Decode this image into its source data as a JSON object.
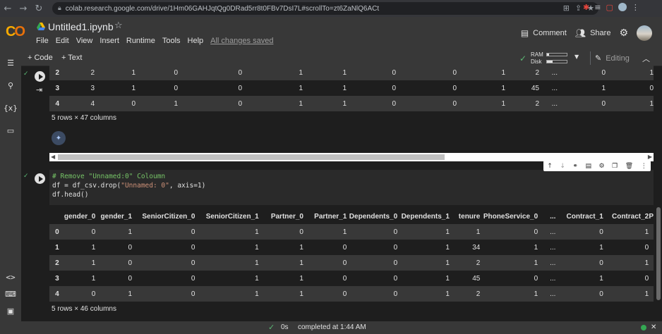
{
  "browser": {
    "url": "colab.research.google.com/drive/1Hm06GAHJqtQg0DRad5rr8t0FBv7DsI7L#scrollTo=zt6ZaNlQ6ACt"
  },
  "header": {
    "title": "Untitled1.ipynb",
    "menu": [
      "File",
      "Edit",
      "View",
      "Insert",
      "Runtime",
      "Tools",
      "Help"
    ],
    "saved_status": "All changes saved",
    "comment_label": "Comment",
    "share_label": "Share"
  },
  "toolbar": {
    "add_code": "+ Code",
    "add_text": "+ Text",
    "ram_label": "RAM",
    "disk_label": "Disk",
    "ram_usage": 0.1,
    "disk_usage": 0.3,
    "editing_label": "Editing"
  },
  "output_top": {
    "rows": [
      [
        "2",
        "2",
        "1",
        "0",
        "0",
        "1",
        "1",
        "0",
        "0",
        "1",
        "2",
        "...",
        "0",
        "1"
      ],
      [
        "3",
        "3",
        "1",
        "0",
        "0",
        "1",
        "1",
        "0",
        "0",
        "1",
        "45",
        "...",
        "1",
        "0"
      ],
      [
        "4",
        "4",
        "0",
        "1",
        "0",
        "1",
        "1",
        "0",
        "0",
        "1",
        "2",
        "...",
        "0",
        "1"
      ]
    ],
    "shape_note": "5 rows × 47 columns"
  },
  "code_cell": {
    "lines": [
      {
        "comment": "# Remove \"Unnamed:0\" Coloumn"
      },
      {
        "pre": "df = df_csv.drop(",
        "str": "\"Unnamed: 0\"",
        "post": ", axis=1)"
      },
      {
        "pre": "df.head()"
      }
    ]
  },
  "output_bottom": {
    "columns": [
      "",
      "gender_0",
      "gender_1",
      "SeniorCitizen_0",
      "SeniorCitizen_1",
      "Partner_0",
      "Partner_1",
      "Dependents_0",
      "Dependents_1",
      "tenure",
      "PhoneService_0",
      "...",
      "Contract_1",
      "Contract_2",
      "P"
    ],
    "rows": [
      [
        "0",
        "0",
        "1",
        "0",
        "1",
        "0",
        "1",
        "0",
        "1",
        "1",
        "0",
        "...",
        "0",
        "1",
        ""
      ],
      [
        "1",
        "1",
        "0",
        "0",
        "1",
        "1",
        "0",
        "0",
        "1",
        "34",
        "1",
        "...",
        "1",
        "0",
        ""
      ],
      [
        "2",
        "1",
        "0",
        "0",
        "1",
        "1",
        "0",
        "0",
        "1",
        "2",
        "1",
        "...",
        "0",
        "1",
        ""
      ],
      [
        "3",
        "1",
        "0",
        "0",
        "1",
        "1",
        "0",
        "0",
        "1",
        "45",
        "0",
        "...",
        "1",
        "0",
        ""
      ],
      [
        "4",
        "0",
        "1",
        "0",
        "1",
        "1",
        "0",
        "0",
        "1",
        "2",
        "1",
        "...",
        "0",
        "1",
        ""
      ]
    ],
    "shape_note": "5 rows × 46 columns"
  },
  "status_bar": {
    "elapsed": "0s",
    "message": "completed at 1:44 AM"
  }
}
